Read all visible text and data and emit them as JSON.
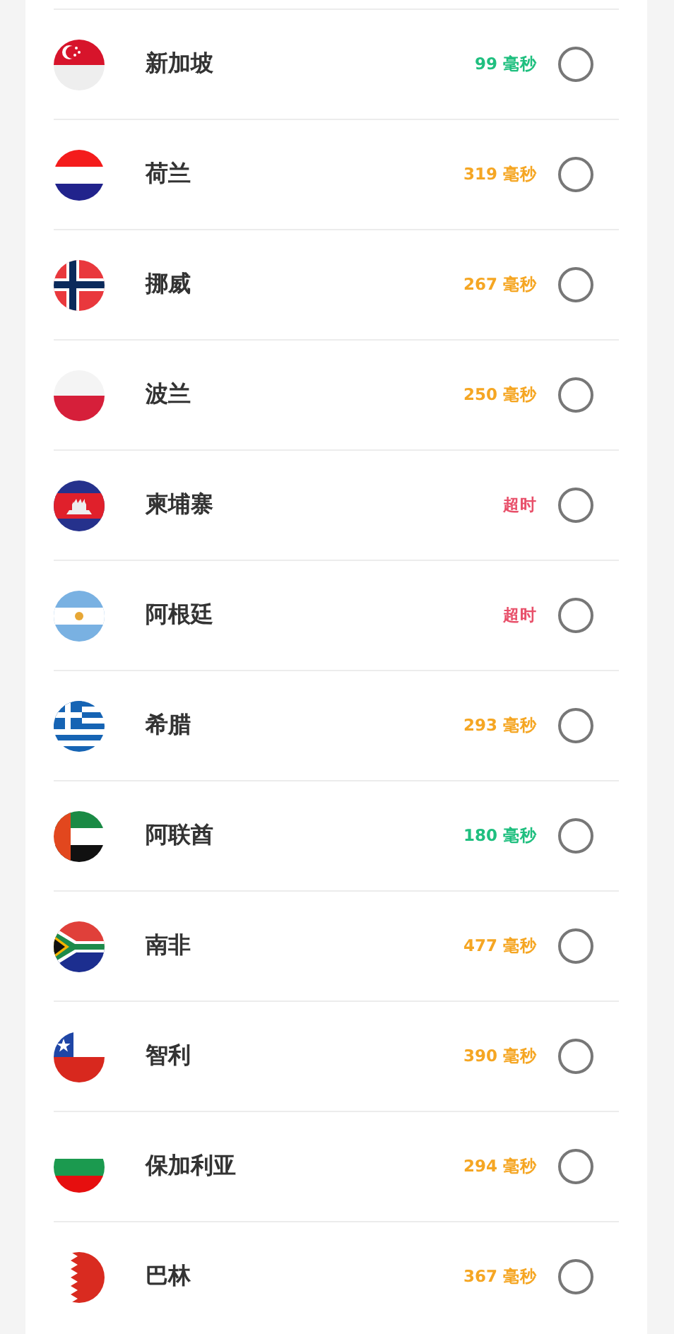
{
  "servers": [
    {
      "kind": "sg",
      "name": "新加坡",
      "latency": "99 毫秒",
      "color": "#1fbf7f",
      "selected": false
    },
    {
      "kind": "nl",
      "name": "荷兰",
      "latency": "319 毫秒",
      "color": "#f5a623",
      "selected": false
    },
    {
      "kind": "no",
      "name": "挪威",
      "latency": "267 毫秒",
      "color": "#f5a623",
      "selected": false
    },
    {
      "kind": "pl",
      "name": "波兰",
      "latency": "250 毫秒",
      "color": "#f5a623",
      "selected": false
    },
    {
      "kind": "kh",
      "name": "柬埔寨",
      "latency": "超时",
      "color": "#e8506a",
      "selected": false
    },
    {
      "kind": "ar",
      "name": "阿根廷",
      "latency": "超时",
      "color": "#e8506a",
      "selected": false
    },
    {
      "kind": "gr",
      "name": "希腊",
      "latency": "293 毫秒",
      "color": "#f5a623",
      "selected": false
    },
    {
      "kind": "ae",
      "name": "阿联酋",
      "latency": "180 毫秒",
      "color": "#1fbf7f",
      "selected": false
    },
    {
      "kind": "za",
      "name": "南非",
      "latency": "477 毫秒",
      "color": "#f5a623",
      "selected": false
    },
    {
      "kind": "cl",
      "name": "智利",
      "latency": "390 毫秒",
      "color": "#f5a623",
      "selected": false
    },
    {
      "kind": "bg",
      "name": "保加利亚",
      "latency": "294 毫秒",
      "color": "#f5a623",
      "selected": false
    },
    {
      "kind": "bh",
      "name": "巴林",
      "latency": "367 毫秒",
      "color": "#f5a623",
      "selected": false
    }
  ]
}
